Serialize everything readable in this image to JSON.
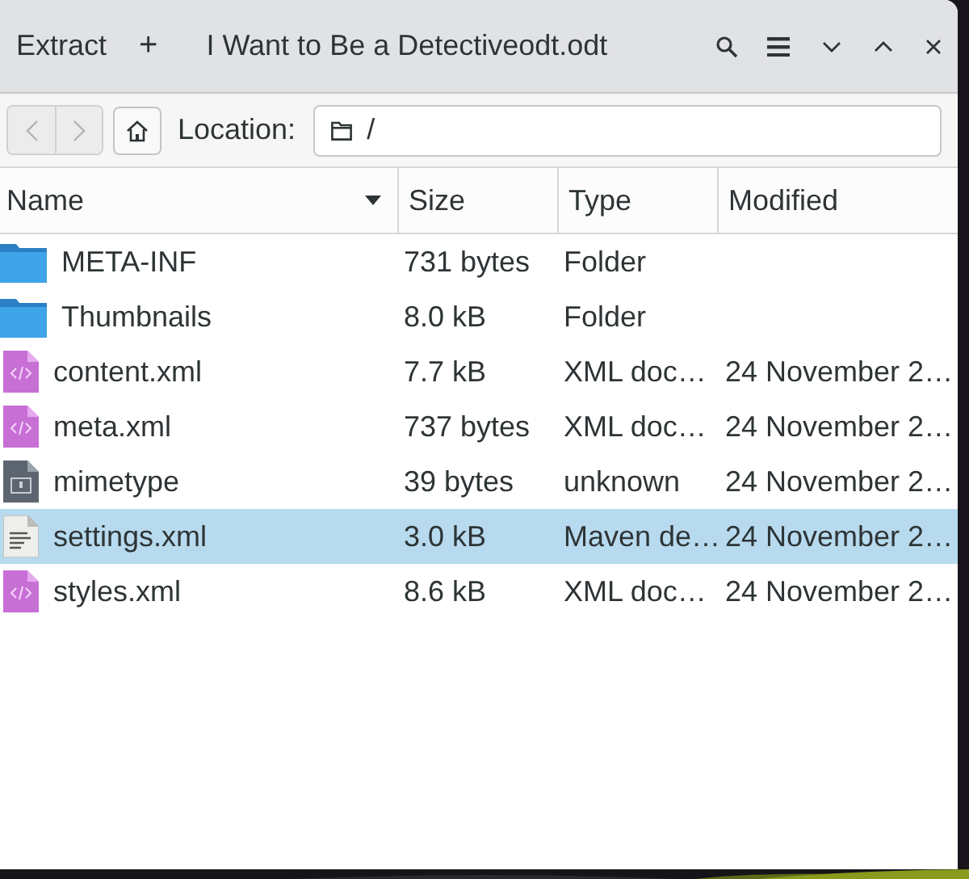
{
  "header": {
    "extract_button": "Extract",
    "new_button": "+",
    "title": "I Want to Be a Detectiveodt.odt"
  },
  "navigation": {
    "back_disabled": true,
    "forward_disabled": true
  },
  "location": {
    "label": "Location:",
    "value": "/"
  },
  "columns": [
    {
      "label": "Name",
      "sorted": true
    },
    {
      "label": "Size",
      "sorted": false
    },
    {
      "label": "Type",
      "sorted": false
    },
    {
      "label": "Modified",
      "sorted": false
    }
  ],
  "rows": [
    {
      "kind": "folder",
      "name": "META-INF",
      "size": "731 bytes",
      "type": "Folder",
      "selected": false
    },
    {
      "kind": "folder",
      "name": "Thumbnails",
      "size": "8.0 kB",
      "type": "Folder",
      "selected": false
    },
    {
      "kind": "xml",
      "name": "content.xml",
      "size": "7.7 kB",
      "type": "XML doc…",
      "modified": "24 November 2…",
      "selected": false
    },
    {
      "kind": "xml",
      "name": "meta.xml",
      "size": "737 bytes",
      "type": "XML doc…",
      "modified": "24 November 2…",
      "selected": false
    },
    {
      "kind": "unknown",
      "name": "mimetype",
      "size": "39 bytes",
      "type": "unknown",
      "modified": "24 November 2…",
      "selected": false
    },
    {
      "kind": "text",
      "name": "settings.xml",
      "size": "3.0 kB",
      "type": "Maven de…",
      "modified": "24 November 2…",
      "selected": true
    },
    {
      "kind": "xml",
      "name": "styles.xml",
      "size": "8.6 kB",
      "type": "XML doc…",
      "modified": "24 November 2…",
      "selected": false
    }
  ]
}
